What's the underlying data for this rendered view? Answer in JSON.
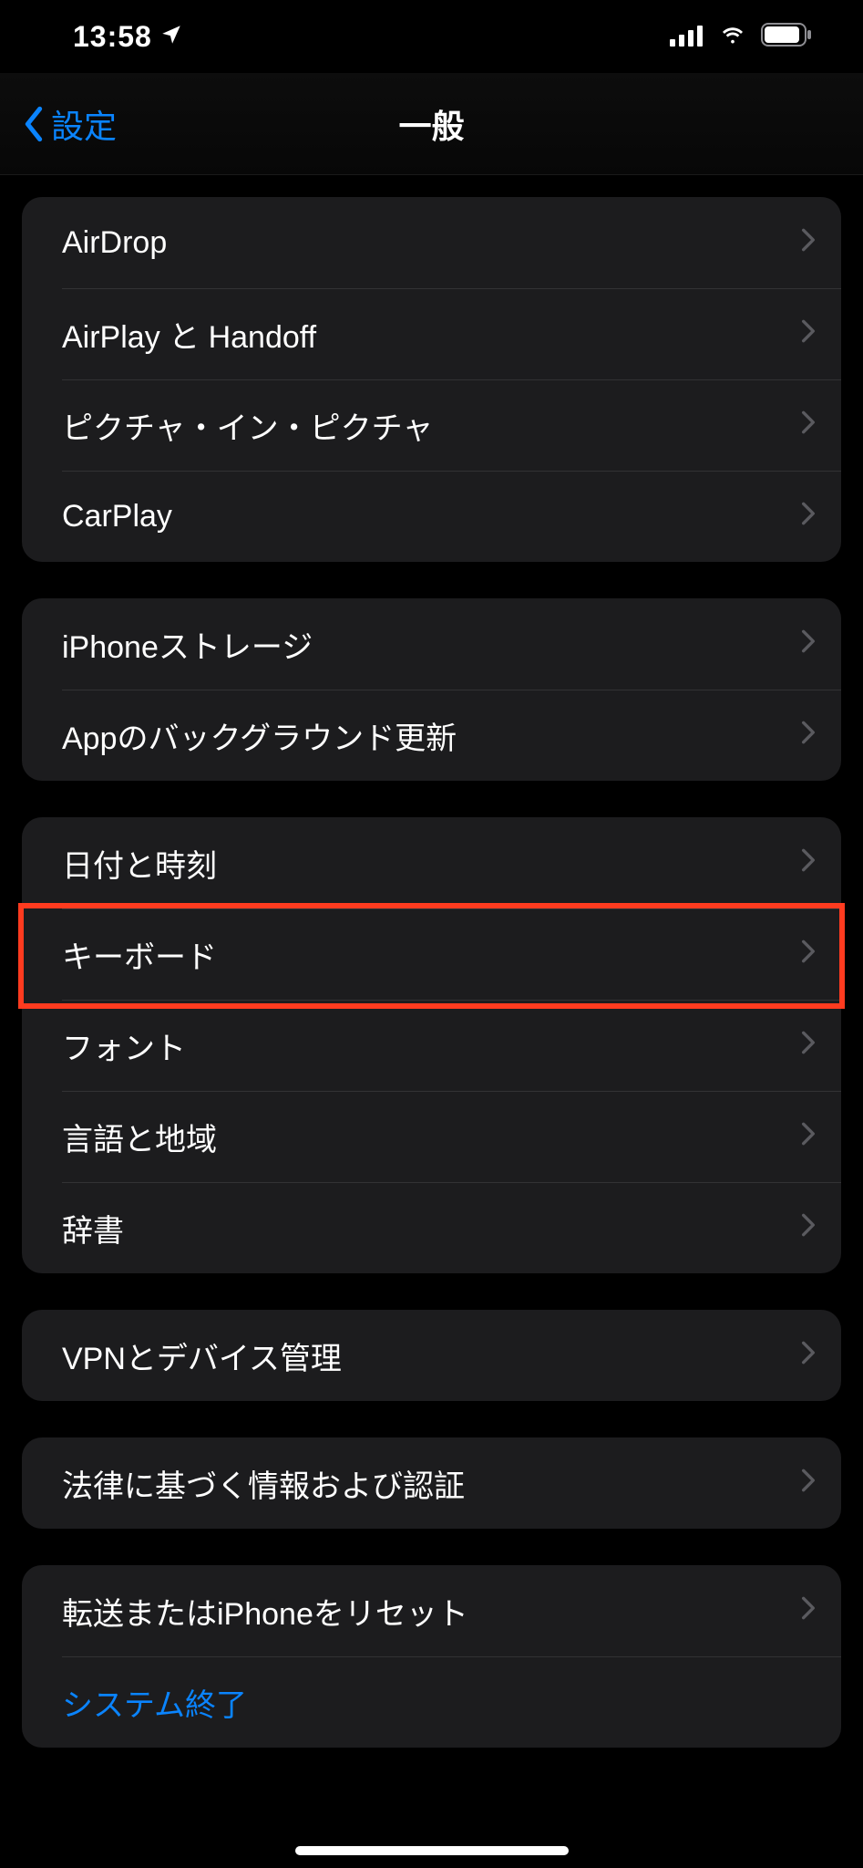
{
  "status": {
    "time": "13:58"
  },
  "nav": {
    "back_label": "設定",
    "title": "一般"
  },
  "groups": [
    {
      "name": "group-airplay",
      "rows": [
        {
          "key": "airdrop",
          "label": "AirDrop"
        },
        {
          "key": "airplay",
          "label": "AirPlay と Handoff"
        },
        {
          "key": "pip",
          "label": "ピクチャ・イン・ピクチャ"
        },
        {
          "key": "carplay",
          "label": "CarPlay"
        }
      ]
    },
    {
      "name": "group-storage",
      "rows": [
        {
          "key": "storage",
          "label": "iPhoneストレージ"
        },
        {
          "key": "bgrefresh",
          "label": "Appのバックグラウンド更新"
        }
      ]
    },
    {
      "name": "group-input",
      "rows": [
        {
          "key": "datetime",
          "label": "日付と時刻"
        },
        {
          "key": "keyboard",
          "label": "キーボード",
          "highlighted": true
        },
        {
          "key": "font",
          "label": "フォント"
        },
        {
          "key": "language",
          "label": "言語と地域"
        },
        {
          "key": "dict",
          "label": "辞書"
        }
      ]
    },
    {
      "name": "group-vpn",
      "rows": [
        {
          "key": "vpn",
          "label": "VPNとデバイス管理"
        }
      ]
    },
    {
      "name": "group-legal",
      "rows": [
        {
          "key": "legal",
          "label": "法律に基づく情報および認証"
        }
      ]
    },
    {
      "name": "group-reset",
      "rows": [
        {
          "key": "transfer",
          "label": "転送またはiPhoneをリセット"
        },
        {
          "key": "shutdown",
          "label": "システム終了",
          "link": true
        }
      ]
    }
  ]
}
